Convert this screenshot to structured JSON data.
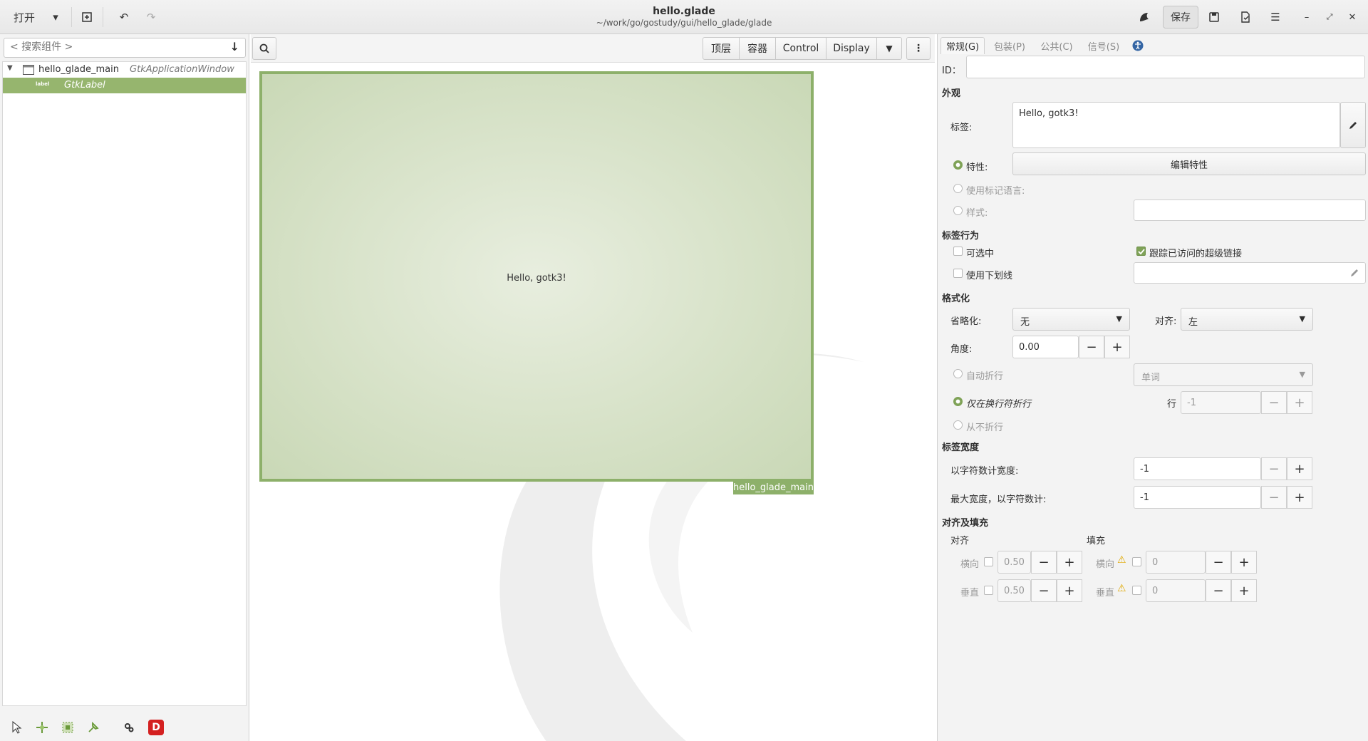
{
  "header": {
    "open_label": "打开",
    "title": "hello.glade",
    "subtitle": "~/work/go/gostudy/gui/hello_glade/glade",
    "save_label": "保存"
  },
  "left_panel": {
    "search_placeholder": "< 搜索组件 >",
    "tree": [
      {
        "name": "hello_glade_main",
        "type": "GtkApplicationWindow"
      },
      {
        "name": "GtkLabel",
        "icon_text": "label"
      }
    ]
  },
  "center": {
    "toolbar": {
      "toplevels": "顶层",
      "containers": "容器",
      "control": "Control",
      "display": "Display"
    },
    "canvas_label_text": "Hello, gotk3!",
    "window_name_tag": "hello_glade_main"
  },
  "right_panel": {
    "tabs": [
      "常规(G)",
      "包装(P)",
      "公共(C)",
      "信号(S)"
    ],
    "id_label": "ID：",
    "id_value": "",
    "appearance": {
      "section": "外观",
      "label_label": "标签:",
      "label_value": "Hello, gotk3!",
      "attributes_label": "特性:",
      "edit_attributes_button": "编辑特性",
      "use_markup_label": "使用标记语言:",
      "style_label": "样式:"
    },
    "behavior": {
      "section": "标签行为",
      "selectable_label": "可选中",
      "track_visited_label": "跟踪已访问的超级链接",
      "use_underline_label": "使用下划线"
    },
    "formatting": {
      "section": "格式化",
      "ellipsize_label": "省略化:",
      "ellipsize_value": "无",
      "justify_label": "对齐:",
      "justify_value": "左",
      "angle_label": "角度:",
      "angle_value": "0.00",
      "auto_wrap_label": "自动折行",
      "wrap_mode_value": "单词",
      "wrap_newline_label": "仅在换行符折行",
      "lines_label": "行",
      "lines_value": "-1",
      "never_wrap_label": "从不折行"
    },
    "label_width": {
      "section": "标签宽度",
      "width_chars_label": "以字符数计宽度:",
      "width_chars_value": "-1",
      "max_width_label": "最大宽度，以字符数计:",
      "max_width_value": "-1"
    },
    "align_pad": {
      "section": "对齐及填充",
      "align_header": "对齐",
      "pad_header": "填充",
      "horizontal_label": "横向",
      "vertical_label": "垂直",
      "xalign_value": "0.50",
      "yalign_value": "0.50",
      "xpad_value": "0",
      "ypad_value": "0"
    }
  },
  "colors": {
    "selection_green": "#96b56e",
    "window_border_green": "#8db06a"
  }
}
